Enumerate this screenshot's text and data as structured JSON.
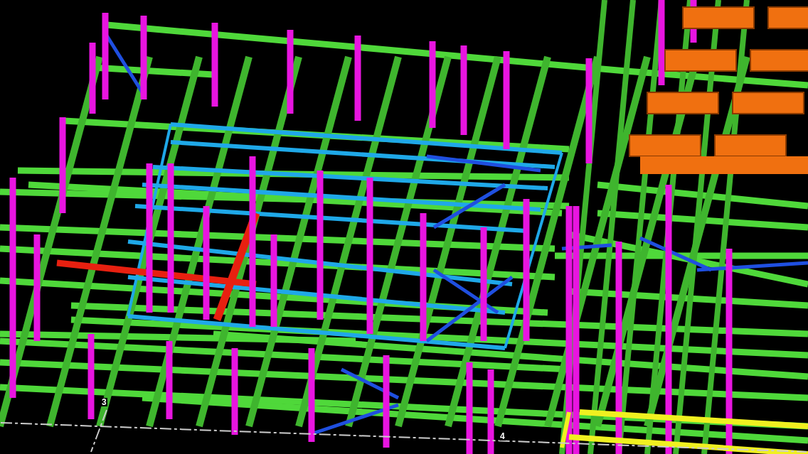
{
  "viewport": {
    "grid_labels": [
      {
        "text": "3"
      },
      {
        "text": "4"
      }
    ]
  }
}
